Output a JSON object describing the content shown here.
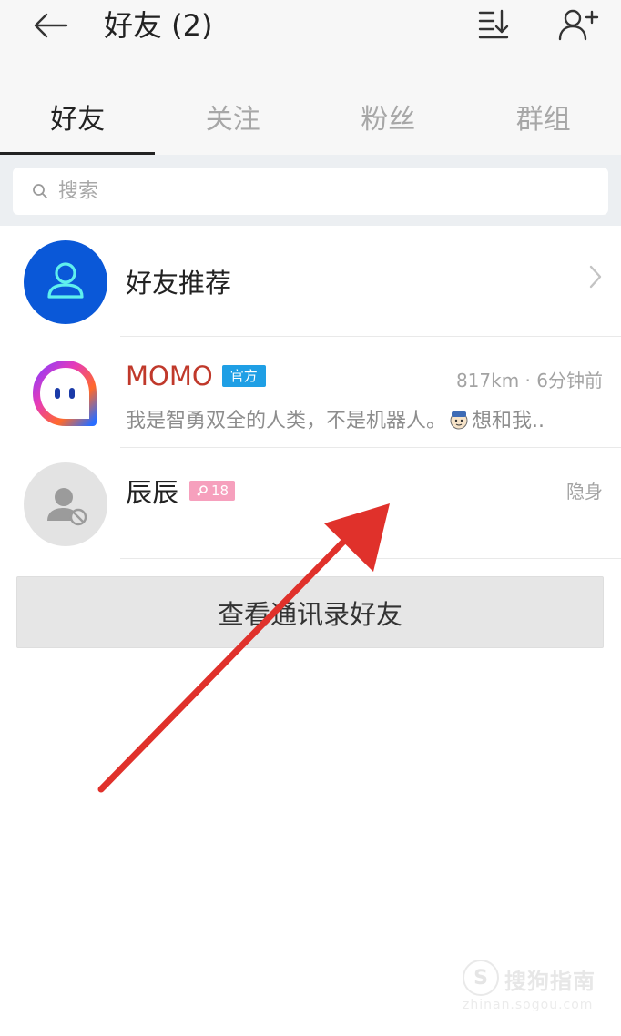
{
  "header": {
    "title": "好友 (2)"
  },
  "tabs": [
    {
      "label": "好友",
      "active": true
    },
    {
      "label": "关注",
      "active": false
    },
    {
      "label": "粉丝",
      "active": false
    },
    {
      "label": "群组",
      "active": false
    }
  ],
  "search": {
    "placeholder": "搜索",
    "value": ""
  },
  "recommend": {
    "label": "好友推荐"
  },
  "friends": [
    {
      "name": "MOMO",
      "badge": "官方",
      "meta": "817km · 6分钟前",
      "message": "我是智勇双全的人类，不是机器人。",
      "message_tail": "想和我.."
    },
    {
      "name": "辰辰",
      "age": "18",
      "status": "隐身"
    }
  ],
  "contacts_button": {
    "label": "查看通讯录好友"
  },
  "watermark": {
    "brand": "搜狗指南",
    "url": "zhinan.sogou.com"
  },
  "colors": {
    "accent_blue": "#0a58d8",
    "official_badge": "#1f9fe5",
    "age_badge": "#f6a0bd",
    "annotation_arrow": "#e0312b"
  },
  "icons": {
    "back": "arrow-left-icon",
    "sort": "sort-icon",
    "add_user": "add-user-icon",
    "search": "search-icon",
    "recommend": "person-icon",
    "chevron": "chevron-right-icon"
  }
}
